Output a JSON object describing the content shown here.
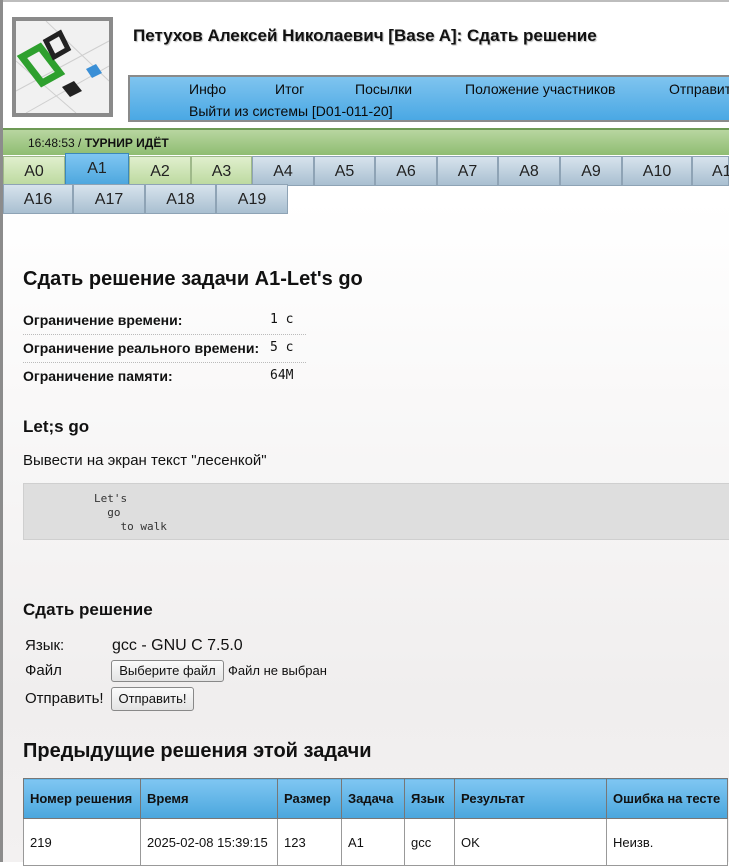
{
  "header": {
    "title": "Петухов Алексей Николаевич [Base A]: Сдать решение"
  },
  "menu": {
    "items": [
      "Инфо",
      "Итог",
      "Посылки",
      "Положение участников",
      "Отправит"
    ],
    "logout": "Выйти из системы [D01-011-20]"
  },
  "status": {
    "time": "16:48:53",
    "separator": " / ",
    "state": "ТУРНИР ИДЁТ"
  },
  "tabs": {
    "row1": [
      "A0",
      "A1",
      "A2",
      "A3",
      "A4",
      "A5",
      "A6",
      "A7",
      "A8",
      "A9",
      "A10",
      "A1"
    ],
    "row2": [
      "A16",
      "A17",
      "A18",
      "A19"
    ],
    "active": "A1",
    "solved": [
      "A0",
      "A2",
      "A3"
    ]
  },
  "problem": {
    "heading": "Сдать решение задачи A1-Let's go",
    "limits": [
      {
        "label": "Ограничение времени:",
        "value": "1 с"
      },
      {
        "label": "Ограничение реального времени:",
        "value": "5 с"
      },
      {
        "label": "Ограничение памяти:",
        "value": "64M"
      }
    ],
    "name": "Let;s go",
    "statement": "Вывести на экран текст \"лесенкой\"",
    "example_lines": [
      "Let's",
      "  go",
      "    to walk"
    ]
  },
  "submit": {
    "heading": "Сдать решение",
    "lang_label": "Язык:",
    "lang_value": "gcc - GNU C 7.5.0",
    "file_label": "Файл",
    "file_button": "Выберите файл",
    "file_status": "Файл не выбран",
    "send_label": "Отправить!",
    "send_button": "Отправить!"
  },
  "history": {
    "heading": "Предыдущие решения этой задачи",
    "columns": [
      "Номер решения",
      "Время",
      "Размер",
      "Задача",
      "Язык",
      "Результат",
      "Ошибка на тесте"
    ],
    "rows": [
      [
        "219",
        "2025-02-08 15:39:15",
        "123",
        "A1",
        "gcc",
        "OK",
        "Неизв."
      ]
    ]
  },
  "colors": {
    "menu_blue": "#4aa8e4",
    "status_green": "#8fbd72",
    "tab_blue": "#a9bfd1",
    "tab_solved": "#bcd99f"
  }
}
